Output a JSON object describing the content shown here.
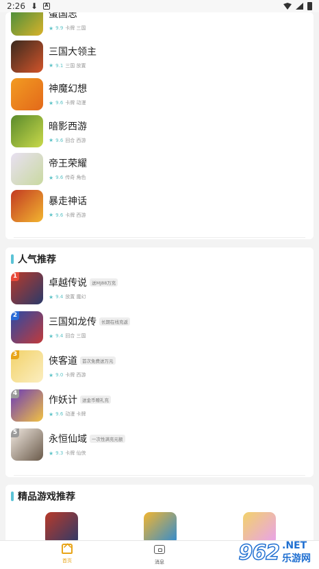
{
  "status_bar": {
    "time": "2:26",
    "a_badge": "A"
  },
  "top_list": [
    {
      "name": "蛋国志",
      "score": "9.9",
      "tags": "卡牌 三国",
      "colors": [
        "#3a8a3e",
        "#d9b22a"
      ]
    },
    {
      "name": "三国大领主",
      "score": "9.1",
      "tags": "三国 放置",
      "colors": [
        "#3a2a1f",
        "#d2542a"
      ]
    },
    {
      "name": "神魔幻想",
      "score": "9.6",
      "tags": "卡牌 动漫",
      "colors": [
        "#f29b22",
        "#e3691a"
      ]
    },
    {
      "name": "暗影西游",
      "score": "9.6",
      "tags": "回合 西游",
      "colors": [
        "#5a8a2c",
        "#c9d94a"
      ]
    },
    {
      "name": "帝王荣耀",
      "score": "9.6",
      "tags": "传奇 角色",
      "colors": [
        "#e8e0f2",
        "#c9d9a0"
      ]
    },
    {
      "name": "暴走神话",
      "score": "9.6",
      "tags": "卡牌 西游",
      "colors": [
        "#c23a22",
        "#f2b530"
      ]
    }
  ],
  "popular_section": {
    "title": "人气推荐",
    "items": [
      {
        "rank": "1",
        "name": "卓越传说",
        "promo": "送MJ88万充",
        "score": "9.4",
        "tags": "放置 魔幻",
        "colors": [
          "#b83a2a",
          "#2a3a6a"
        ],
        "rank_color": "#e84a3a"
      },
      {
        "rank": "2",
        "name": "三国如龙传",
        "promo": "长期在线充返",
        "score": "9.4",
        "tags": "回合 三国",
        "colors": [
          "#2a4aa6",
          "#c23a3a"
        ],
        "rank_color": "#2a6ad6"
      },
      {
        "rank": "3",
        "name": "侠客道",
        "promo": "首次免费送万元",
        "score": "9.0",
        "tags": "卡牌 西游",
        "colors": [
          "#f2d26a",
          "#fbeec0"
        ],
        "rank_color": "#e8a417"
      },
      {
        "rank": "4",
        "name": "作妖计",
        "promo": "送金币赠礼充",
        "score": "9.6",
        "tags": "动漫 卡牌",
        "colors": [
          "#6a3ab8",
          "#f2c242"
        ],
        "rank_color": "#9a9a9a"
      },
      {
        "rank": "5",
        "name": "永恒仙域",
        "promo": "一次性满充元额",
        "score": "9.3",
        "tags": "卡牌 仙侠",
        "colors": [
          "#f0e8e0",
          "#6a5a4a"
        ],
        "rank_color": "#9a9a9a"
      }
    ]
  },
  "featured_section": {
    "title": "精品游戏推荐",
    "icons": [
      {
        "colors": [
          "#b83a2a",
          "#2a3a6a"
        ]
      },
      {
        "colors": [
          "#f2b530",
          "#2a8ad6"
        ]
      },
      {
        "colors": [
          "#f2d26a",
          "#e8a0f0"
        ]
      }
    ]
  },
  "tab_bar": {
    "home": "首页",
    "messages": "消息"
  },
  "watermark": {
    "number": "962",
    "domain": ".NET",
    "cn": "乐游网"
  }
}
